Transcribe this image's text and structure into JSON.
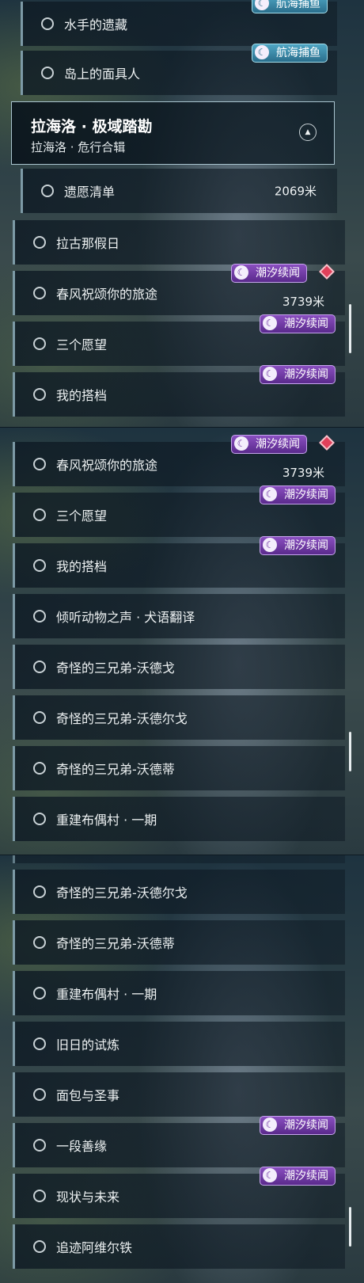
{
  "badges": {
    "sailing_fishing": "航海捕鱼",
    "tidal_tales": "潮汐续闻",
    "badge_icon": "crescent-wave-icon"
  },
  "section": {
    "title": "拉海洛 · 极域踏勘",
    "subtitle": "拉海洛 · 危行合辑"
  },
  "panel1": {
    "items": [
      {
        "label": "水手的遗藏"
      },
      {
        "label": "岛上的面具人"
      },
      {
        "label": "遗愿清单",
        "distance": "2069米"
      },
      {
        "label": "拉古那假日"
      },
      {
        "label": "春风祝颂你的旅途",
        "distance": "3739米"
      },
      {
        "label": "三个愿望"
      },
      {
        "label": "我的搭档"
      }
    ]
  },
  "panel2": {
    "items": [
      {
        "label": "春风祝颂你的旅途",
        "distance": "3739米"
      },
      {
        "label": "三个愿望"
      },
      {
        "label": "我的搭档"
      },
      {
        "label": "倾听动物之声 · 犬语翻译"
      },
      {
        "label": "奇怪的三兄弟-沃德戈"
      },
      {
        "label": "奇怪的三兄弟-沃德尔戈"
      },
      {
        "label": "奇怪的三兄弟-沃德蒂"
      },
      {
        "label": "重建布偶村 · 一期"
      }
    ]
  },
  "panel3": {
    "items": [
      {
        "label": "奇怪的三兄弟-沃德尔戈"
      },
      {
        "label": "奇怪的三兄弟-沃德蒂"
      },
      {
        "label": "重建布偶村 · 一期"
      },
      {
        "label": "旧日的试炼"
      },
      {
        "label": "面包与圣事"
      },
      {
        "label": "一段善缘"
      },
      {
        "label": "现状与未来"
      },
      {
        "label": "追迹阿维尔铁"
      }
    ]
  },
  "colors": {
    "tidal_badge": "#6a35a0",
    "sailing_badge": "#3f8fae",
    "tracked_marker": "#e0405a",
    "row_accent": "#7d9aa6"
  }
}
